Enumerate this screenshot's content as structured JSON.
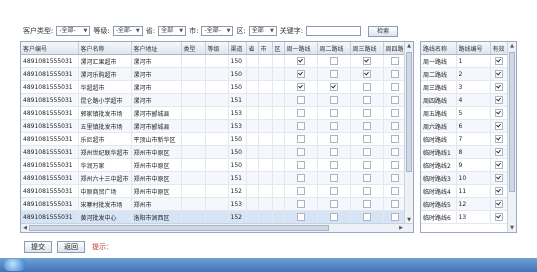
{
  "filters": {
    "customer_type_label": "客户类型:",
    "customer_type_value": "-全部-",
    "level_label": "等级:",
    "level_value": "-全部-",
    "province_label": "省:",
    "province_value": "全部",
    "city_label": "市:",
    "city_value": "-全部-",
    "district_label": "区:",
    "district_value": "全部",
    "keyword_label": "关键字:",
    "keyword_value": "",
    "search_label": "检索"
  },
  "main_grid": {
    "columns": [
      "客户编号",
      "客户名称",
      "客户地址",
      "类型",
      "等级",
      "渠道",
      "省",
      "市",
      "区",
      "周一路线",
      "周二路线",
      "周三路线",
      "周四路"
    ],
    "rows": [
      {
        "id": "4891081555031",
        "name": "漯河汇果超市",
        "addr": "漯河市",
        "channel": "150",
        "d1": true,
        "d2": false,
        "d3": true,
        "d4": false
      },
      {
        "id": "4891081555031",
        "name": "漯河乐购超市",
        "addr": "漯河市",
        "channel": "150",
        "d1": true,
        "d2": false,
        "d3": true,
        "d4": false
      },
      {
        "id": "4891081555031",
        "name": "华超超市",
        "addr": "漯河市",
        "channel": "150",
        "d1": true,
        "d2": true,
        "d3": false,
        "d4": false
      },
      {
        "id": "4891081555031",
        "name": "昆仑路小学超市",
        "addr": "漯河市",
        "channel": "151",
        "d1": false,
        "d2": false,
        "d3": false,
        "d4": false
      },
      {
        "id": "4891081555031",
        "name": "郭家镇批发市场",
        "addr": "漯河市郾城县",
        "channel": "153",
        "d1": false,
        "d2": false,
        "d3": false,
        "d4": false
      },
      {
        "id": "4891081555031",
        "name": "五里镇批发市场",
        "addr": "漯河市郾城县",
        "channel": "153",
        "d1": false,
        "d2": false,
        "d3": false,
        "d4": false
      },
      {
        "id": "4891081555031",
        "name": "乐尼超市",
        "addr": "平顶山市新华区",
        "channel": "150",
        "d1": false,
        "d2": false,
        "d3": false,
        "d4": false
      },
      {
        "id": "4891081555031",
        "name": "郑州世纪联华超市",
        "addr": "郑州市中原区",
        "channel": "150",
        "d1": false,
        "d2": false,
        "d3": false,
        "d4": false
      },
      {
        "id": "4891081555031",
        "name": "华润万家",
        "addr": "郑州市中原区",
        "channel": "150",
        "d1": false,
        "d2": false,
        "d3": false,
        "d4": false
      },
      {
        "id": "4891081555031",
        "name": "郑州六十三中超市",
        "addr": "郑州市中原区",
        "channel": "151",
        "d1": false,
        "d2": false,
        "d3": false,
        "d4": false
      },
      {
        "id": "4891081555031",
        "name": "中原商贸广场",
        "addr": "郑州市中原区",
        "channel": "152",
        "d1": false,
        "d2": false,
        "d3": false,
        "d4": false
      },
      {
        "id": "4891081555031",
        "name": "宋寨村批发市场",
        "addr": "郑州市",
        "channel": "153",
        "d1": false,
        "d2": false,
        "d3": false,
        "d4": false
      },
      {
        "id": "4891081555031",
        "name": "黄河批发中心",
        "addr": "洛阳市涧西区",
        "channel": "152",
        "d1": false,
        "d2": false,
        "d3": false,
        "d4": false
      }
    ]
  },
  "route_grid": {
    "columns": [
      "路线名称",
      "路线编号",
      "有效"
    ],
    "rows": [
      {
        "name": "周一路线",
        "code": "1",
        "valid": true
      },
      {
        "name": "周二路线",
        "code": "2",
        "valid": true
      },
      {
        "name": "周三路线",
        "code": "3",
        "valid": true
      },
      {
        "name": "周四路线",
        "code": "4",
        "valid": true
      },
      {
        "name": "周五路线",
        "code": "5",
        "valid": true
      },
      {
        "name": "周六路线",
        "code": "6",
        "valid": true
      },
      {
        "name": "临时路线",
        "code": "7",
        "valid": true
      },
      {
        "name": "临时路线1",
        "code": "8",
        "valid": true
      },
      {
        "name": "临时路线2",
        "code": "9",
        "valid": true
      },
      {
        "name": "临时路线3",
        "code": "10",
        "valid": true
      },
      {
        "name": "临时路线4",
        "code": "11",
        "valid": true
      },
      {
        "name": "临时路线5",
        "code": "12",
        "valid": true
      },
      {
        "name": "临时路线6",
        "code": "13",
        "valid": true
      }
    ]
  },
  "actions": {
    "submit_label": "提交",
    "back_label": "返回",
    "hint_label": "提示："
  }
}
